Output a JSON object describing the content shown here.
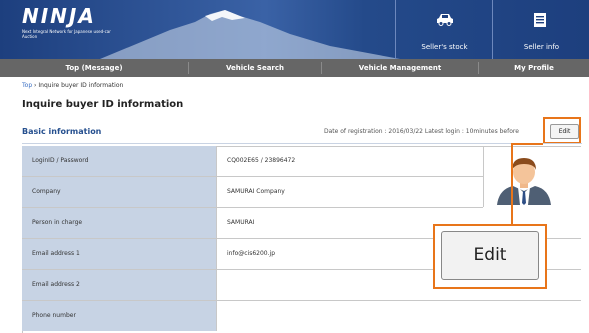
{
  "header": {
    "logo": "NINJA",
    "tagline": "Next Integral Network for Japanese used-car Auction",
    "sellers_stock_label": "Seller's stock",
    "seller_info_label": "Seller info"
  },
  "nav": {
    "items": [
      {
        "label": "Top (Message)"
      },
      {
        "label": "Vehicle Search"
      },
      {
        "label": "Vehicle Management"
      },
      {
        "label": "My Profile"
      }
    ]
  },
  "breadcrumb": {
    "top": "Top",
    "sep": "›",
    "current": "Inquire buyer ID information"
  },
  "page": {
    "title": "Inquire buyer ID information"
  },
  "section": {
    "title": "Basic information",
    "meta": "Date of registration : 2016/03/22   Latest login : 10minutes before",
    "edit_label": "Edit"
  },
  "table": {
    "rows": [
      {
        "label": "LoginID / Password",
        "value": "CQ002E65 / 23896472"
      },
      {
        "label": "Company",
        "value": "SAMURAI Company"
      },
      {
        "label": "Person in charge",
        "value": "SAMURAI"
      },
      {
        "label": "Email address 1",
        "value": "info@cis6200.jp"
      },
      {
        "label": "Email address 2",
        "value": ""
      },
      {
        "label": "Phone number",
        "value": ""
      }
    ]
  },
  "callout": {
    "edit_label": "Edit"
  },
  "colors": {
    "header_blue": "#1d3f7e",
    "nav_gray": "#666666",
    "label_blue": "#c7d3e4",
    "highlight_orange": "#e8751a",
    "section_blue": "#26508f"
  },
  "icons": {
    "stock": "car-icon",
    "seller": "document-icon",
    "avatar": "person-avatar-icon"
  }
}
